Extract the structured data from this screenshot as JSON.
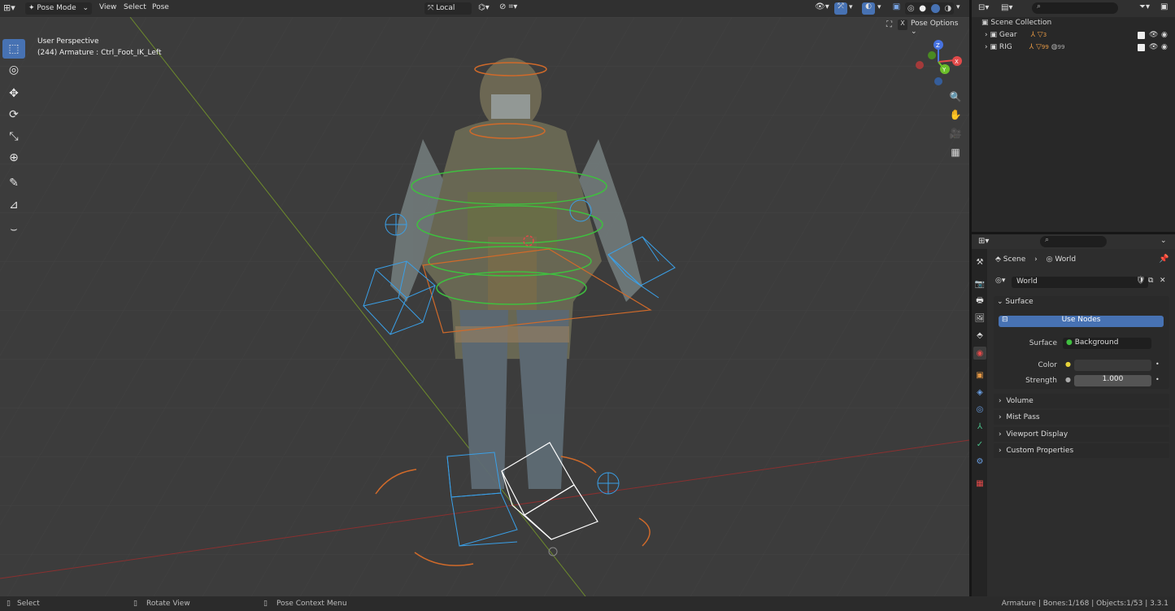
{
  "header": {
    "mode": "Pose Mode",
    "menus": [
      "View",
      "Select",
      "Pose"
    ],
    "transform_orientation": "Local",
    "pose_options": "Pose Options",
    "close_label": "X"
  },
  "viewport": {
    "view_name": "User Perspective",
    "active_info": "(244) Armature : Ctrl_Foot_IK_Left",
    "gizmo_axes": [
      "X",
      "Y",
      "Z"
    ]
  },
  "tools": [
    {
      "name": "select-box-tool",
      "icon": "cursor-icon",
      "glyph": "⬚",
      "active": true
    },
    {
      "name": "cursor-tool",
      "icon": "cursor-3d-icon",
      "glyph": "◎",
      "active": false
    },
    {
      "name": "move-tool",
      "icon": "move-icon",
      "glyph": "✥",
      "active": false
    },
    {
      "name": "rotate-tool",
      "icon": "rotate-icon",
      "glyph": "⟳",
      "active": false
    },
    {
      "name": "scale-tool",
      "icon": "scale-icon",
      "glyph": "⤡",
      "active": false
    },
    {
      "name": "transform-tool",
      "icon": "transform-icon",
      "glyph": "⊕",
      "active": false
    },
    {
      "name": "annotate-tool",
      "icon": "pencil-icon",
      "glyph": "✎",
      "active": false
    },
    {
      "name": "measure-tool",
      "icon": "ruler-icon",
      "glyph": "📐",
      "active": false
    },
    {
      "name": "pose-relax-tool",
      "icon": "curve-icon",
      "glyph": "⌣",
      "active": false
    }
  ],
  "outliner": {
    "root": "Scene Collection",
    "items": [
      {
        "label": "Gear",
        "count": "3"
      },
      {
        "label": "RIG",
        "count": "99"
      }
    ],
    "extra_count": "99"
  },
  "properties": {
    "breadcrumb": [
      "Scene",
      "World"
    ],
    "world_name": "World",
    "surface_panel": "Surface",
    "use_nodes_label": "Use Nodes",
    "surface_label": "Surface",
    "surface_value": "Background",
    "color_label": "Color",
    "strength_label": "Strength",
    "strength_value": "1.000",
    "collapsed_panels": [
      "Volume",
      "Mist Pass",
      "Viewport Display",
      "Custom Properties"
    ]
  },
  "statusbar": {
    "left": [
      {
        "label": "Select",
        "icon": "mouse-left-icon"
      },
      {
        "label": "Rotate View",
        "icon": "mouse-middle-icon"
      },
      {
        "label": "Pose Context Menu",
        "icon": "mouse-right-icon"
      }
    ],
    "stats": "Armature | Bones:1/168 | Objects:1/53 | 3.3.1"
  },
  "colors": {
    "accent": "#4772b3",
    "bone_green": "#3fbf3f",
    "bone_orange": "#d06a2a",
    "bone_blue": "#3aa0e8",
    "grid_bg": "#3d3d3d"
  }
}
